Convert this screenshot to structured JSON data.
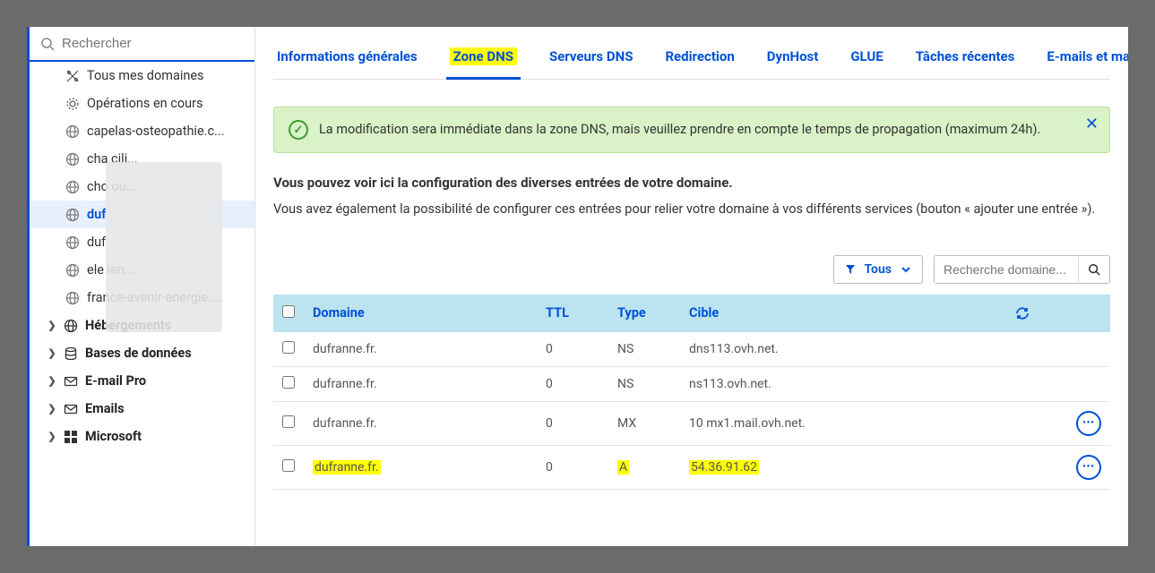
{
  "search": {
    "placeholder": "Rechercher"
  },
  "sidebar": {
    "domains_root": "Tous mes domaines",
    "operations": "Opérations en cours",
    "domains": [
      "capelas-osteopathie.c...",
      "cha                         cili...",
      "cho                         ou...",
      "duf",
      "duf",
      "ele                         ien...",
      "france-avenir-energie...."
    ],
    "active_index": 3,
    "sections": [
      "Hébergements",
      "Bases de données",
      "E-mail Pro",
      "Emails",
      "Microsoft"
    ]
  },
  "tabs": [
    "Informations générales",
    "Zone DNS",
    "Serveurs DNS",
    "Redirection",
    "DynHost",
    "GLUE",
    "Tâches récentes",
    "E-mails et mai"
  ],
  "active_tab": 1,
  "alert": "La modification sera immédiate dans la zone DNS, mais veuillez prendre en compte le temps de propagation (maximum 24h).",
  "desc_strong": "Vous pouvez voir ici la configuration des diverses entrées de votre domaine.",
  "desc_normal": "Vous avez également la possibilité de configurer ces entrées pour relier votre domaine à vos différents services (bouton « ajouter une entrée »).",
  "filter": {
    "label": "Tous"
  },
  "search_domain": {
    "placeholder": "Recherche domaine..."
  },
  "table": {
    "headers": {
      "domain": "Domaine",
      "ttl": "TTL",
      "type": "Type",
      "target": "Cible"
    },
    "rows": [
      {
        "domain": "dufranne.fr.",
        "ttl": "0",
        "type": "NS",
        "target": "dns113.ovh.net.",
        "actions": false,
        "highlight": false
      },
      {
        "domain": "dufranne.fr.",
        "ttl": "0",
        "type": "NS",
        "target": "ns113.ovh.net.",
        "actions": false,
        "highlight": false
      },
      {
        "domain": "dufranne.fr.",
        "ttl": "0",
        "type": "MX",
        "target": "10 mx1.mail.ovh.net.",
        "actions": true,
        "highlight": false
      },
      {
        "domain": "dufranne.fr.",
        "ttl": "0",
        "type": "A",
        "target": "54.36.91.62",
        "actions": true,
        "highlight": true
      }
    ]
  }
}
